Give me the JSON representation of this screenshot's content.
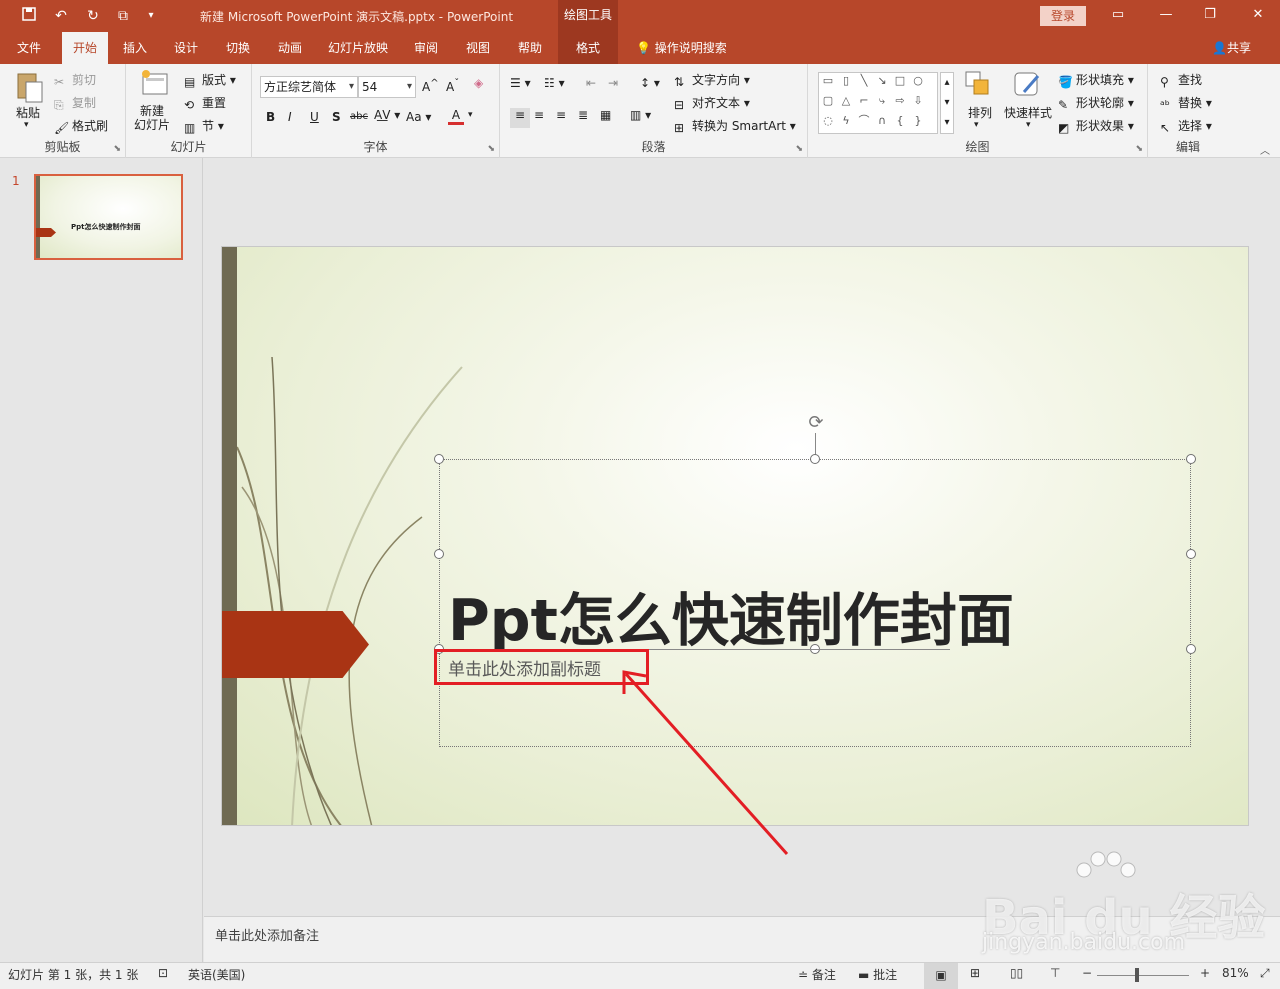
{
  "window": {
    "title": "新建 Microsoft PowerPoint 演示文稿.pptx  -  PowerPoint",
    "contextual_group": "绘图工具",
    "login": "登录"
  },
  "tabs": [
    {
      "label": "文件"
    },
    {
      "label": "开始"
    },
    {
      "label": "插入"
    },
    {
      "label": "设计"
    },
    {
      "label": "切换"
    },
    {
      "label": "动画"
    },
    {
      "label": "幻灯片放映"
    },
    {
      "label": "审阅"
    },
    {
      "label": "视图"
    },
    {
      "label": "帮助"
    },
    {
      "label": "格式"
    }
  ],
  "tell_me": "操作说明搜索",
  "share": "共享",
  "ribbon": {
    "clipboard": {
      "label": "剪贴板",
      "paste": "粘贴",
      "cut": "剪切",
      "copy": "复制",
      "format_painter": "格式刷"
    },
    "slides": {
      "label": "幻灯片",
      "new_slide": "新建\n幻灯片",
      "layout": "版式",
      "reset": "重置",
      "section": "节"
    },
    "font": {
      "label": "字体",
      "font_name": "方正综艺简体",
      "font_size": "54"
    },
    "paragraph": {
      "label": "段落",
      "text_direction": "文字方向",
      "align_text": "对齐文本",
      "convert_smartart": "转换为 SmartArt"
    },
    "drawing": {
      "label": "绘图",
      "arrange": "排列",
      "quick_styles": "快速样式",
      "shape_fill": "形状填充",
      "shape_outline": "形状轮廓",
      "shape_effects": "形状效果"
    },
    "editing": {
      "label": "编辑",
      "find": "查找",
      "replace": "替换",
      "select": "选择"
    }
  },
  "thumbnail": {
    "number": "1",
    "title": "Ppt怎么快速制作封面"
  },
  "slide": {
    "title": "Ppt怎么快速制作封面",
    "subtitle_placeholder": "单击此处添加副标题"
  },
  "notes_placeholder": "单击此处添加备注",
  "status": {
    "slide_count": "幻灯片 第 1 张，共 1 张",
    "language": "英语(美国)",
    "notes": "备注",
    "comments": "批注",
    "zoom": "81%"
  },
  "watermark": {
    "logo": "Bai du 经验",
    "url": "jingyan.baidu.com"
  },
  "colors": {
    "accent": "#b7472a",
    "chevron": "#a93414",
    "highlight": "#e31e24"
  }
}
